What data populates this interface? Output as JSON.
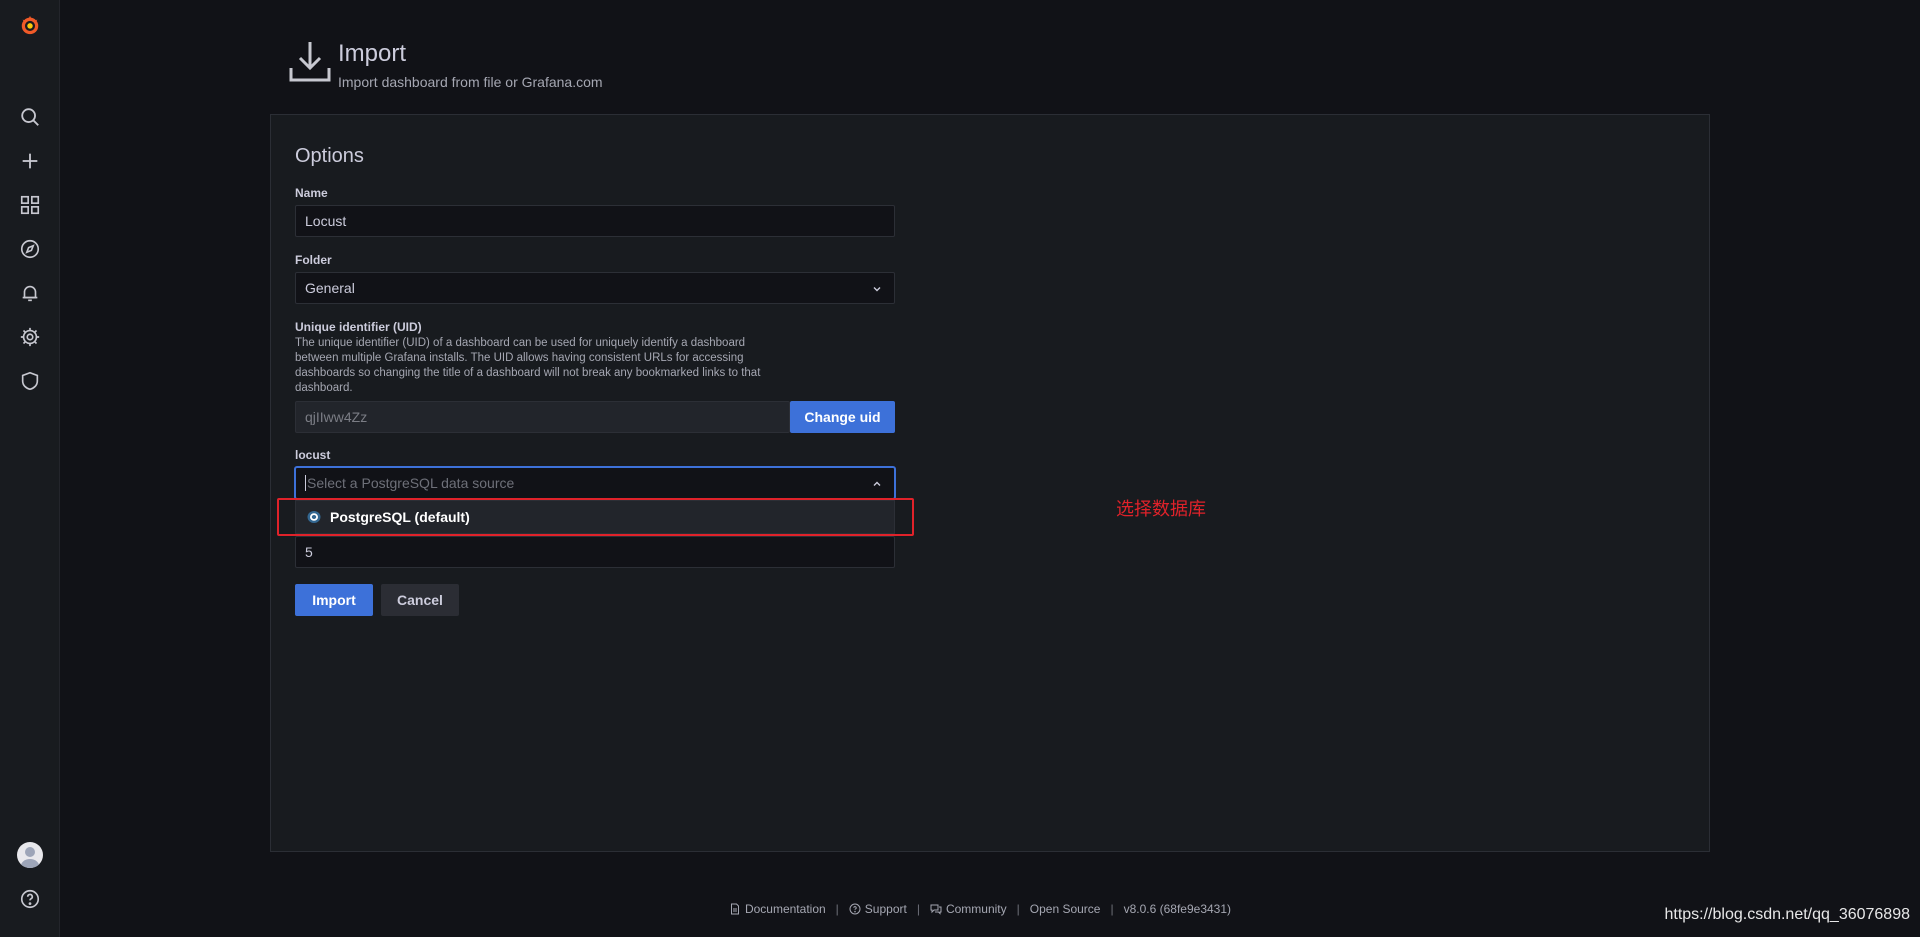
{
  "sidebar": {
    "items": [
      {
        "icon": "grafana-logo-icon"
      },
      {
        "icon": "search-icon"
      },
      {
        "icon": "plus-icon"
      },
      {
        "icon": "dashboards-icon"
      },
      {
        "icon": "explore-icon"
      },
      {
        "icon": "bell-icon"
      },
      {
        "icon": "gear-icon"
      },
      {
        "icon": "shield-icon"
      },
      {
        "icon": "avatar"
      },
      {
        "icon": "help-icon"
      }
    ]
  },
  "header": {
    "icon": "import-icon",
    "title": "Import",
    "subtitle": "Import dashboard from file or Grafana.com"
  },
  "options": {
    "title": "Options",
    "name_label": "Name",
    "name_value": "Locust",
    "folder_label": "Folder",
    "folder_value": "General",
    "uid_label": "Unique identifier (UID)",
    "uid_description": "The unique identifier (UID) of a dashboard can be used for uniquely identify a dashboard between multiple Grafana installs. The UID allows having consistent URLs for accessing dashboards so changing the title of a dashboard will not break any bookmarked links to that dashboard.",
    "uid_value": "qjIIww4Zz",
    "change_uid_label": "Change uid",
    "datasource_label": "locust",
    "datasource_placeholder": "Select a PostgreSQL data source",
    "dropdown_option": "PostgreSQL (default)",
    "hidden_field_value": "5",
    "import_label": "Import",
    "cancel_label": "Cancel"
  },
  "annotation": "选择数据库",
  "footer": {
    "documentation": "Documentation",
    "support": "Support",
    "community": "Community",
    "open_source": "Open Source",
    "version": "v8.0.6 (68fe9e3431)"
  },
  "watermark": "https://blog.csdn.net/qq_36076898",
  "colors": {
    "background": "#111217",
    "panel": "#181b1f",
    "primary": "#3d71d9",
    "annotation_red": "#e0222a",
    "grafana_orange": "#f05a28"
  }
}
